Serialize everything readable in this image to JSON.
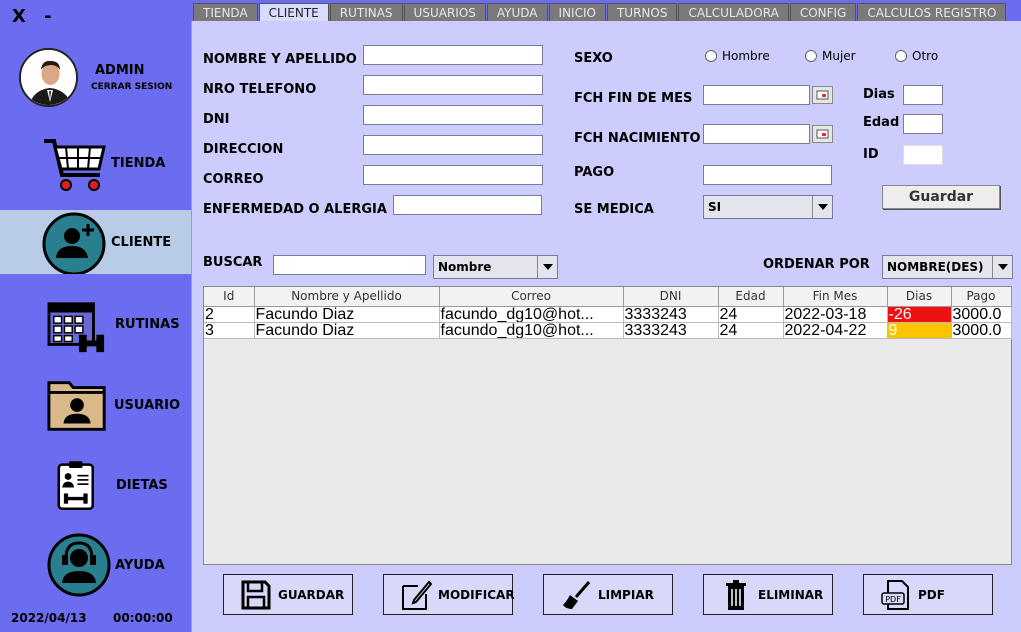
{
  "window": {
    "close": "X",
    "minimize": "-"
  },
  "profile": {
    "name": "ADMIN",
    "logout": "CERRAR SESION"
  },
  "nav": [
    {
      "label": "TIENDA",
      "icon": "shopping-cart-icon"
    },
    {
      "label": "CLIENTE",
      "icon": "add-user-icon",
      "active": true
    },
    {
      "label": "RUTINAS",
      "icon": "calendar-dumbbell-icon"
    },
    {
      "label": "USUARIO",
      "icon": "user-folder-icon"
    },
    {
      "label": "DIETAS",
      "icon": "diet-clipboard-icon"
    },
    {
      "label": "AYUDA",
      "icon": "support-headset-icon"
    }
  ],
  "footer": {
    "date": "2022/04/13",
    "time": "00:00:00"
  },
  "tabs": [
    "TIENDA",
    "CLIENTE",
    "RUTINAS",
    "USUARIOS",
    "AYUDA",
    "INICIO",
    "TURNOS",
    "CALCULADORA",
    "CONFIG",
    "CALCULOS REGISTRO"
  ],
  "form": {
    "nombre": "NOMBRE Y APELLIDO",
    "telefono": "NRO TELEFONO",
    "dni": "DNI",
    "direccion": "DIRECCION",
    "correo": "CORREO",
    "enfermedad": "ENFERMEDAD O ALERGIA",
    "sexo": "SEXO",
    "sexo_options": [
      "Hombre",
      "Mujer",
      "Otro"
    ],
    "fch_fin": "FCH FIN DE MES",
    "fch_nac": "FCH NACIMIENTO",
    "pago": "PAGO",
    "se_medica": "SE MEDICA",
    "se_medica_value": "SI",
    "dias": "Dias",
    "edad": "Edad",
    "id": "ID",
    "guardar": "Guardar"
  },
  "search": {
    "label": "BUSCAR",
    "filter": "Nombre",
    "order_label": "ORDENAR POR",
    "order_value": "NOMBRE(DES)"
  },
  "table": {
    "headers": [
      "Id",
      "Nombre y Apellido",
      "Correo",
      "DNI",
      "Edad",
      "Fin Mes",
      "Dias",
      "Pago"
    ],
    "rows": [
      [
        "2",
        "Facundo Diaz",
        "facundo_dg10@hot...",
        "3333243",
        "24",
        "2022-03-18",
        "-26",
        "3000.0"
      ],
      [
        "3",
        "Facundo Diaz",
        "facundo_dg10@hot...",
        "3333243",
        "24",
        "2022-04-22",
        "9",
        "3000.0"
      ]
    ],
    "dias_status": [
      "overdue",
      "warning"
    ],
    "status_colors": {
      "overdue": "#ee1111",
      "warning": "#ffc400"
    }
  },
  "actions": [
    {
      "label": "GUARDAR",
      "icon": "floppy-disk-icon"
    },
    {
      "label": "MODIFICAR",
      "icon": "edit-pencil-icon"
    },
    {
      "label": "LIMPIAR",
      "icon": "broom-icon"
    },
    {
      "label": "ELIMINAR",
      "icon": "trash-icon"
    },
    {
      "label": "PDF",
      "icon": "pdf-file-icon"
    }
  ]
}
